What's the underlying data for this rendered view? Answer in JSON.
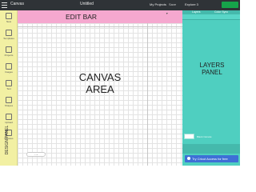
{
  "topbar": {
    "app_title": "Canvas",
    "document_title": "Untitled",
    "my_projects_label": "My Projects",
    "save_label": "Save",
    "machine_label": "Explore 3",
    "make_it_color": "#16a34a"
  },
  "sections": {
    "edit_bar_label": "EDIT BAR",
    "canvas_label": "CANVAS\nAREA",
    "layers_label": "LAYERS\nPANEL",
    "design_panel_label": "DESIGN PANEL"
  },
  "design_panel": {
    "tools": [
      "New",
      "Templates",
      "Projects",
      "Images",
      "Text",
      "Shapes",
      "Upload",
      "Phrases"
    ]
  },
  "layers_panel": {
    "tabs": [
      "Layers",
      "Color Sync"
    ],
    "blank_canvas_label": "Blank Canvas",
    "access_button_label": "Try Cricut Access for free"
  },
  "colors": {
    "edit_bar": "#f5a8cf",
    "design_panel": "#f2f0a3",
    "layers_panel": "#4fcfc0",
    "topbar": "#2f3337"
  }
}
